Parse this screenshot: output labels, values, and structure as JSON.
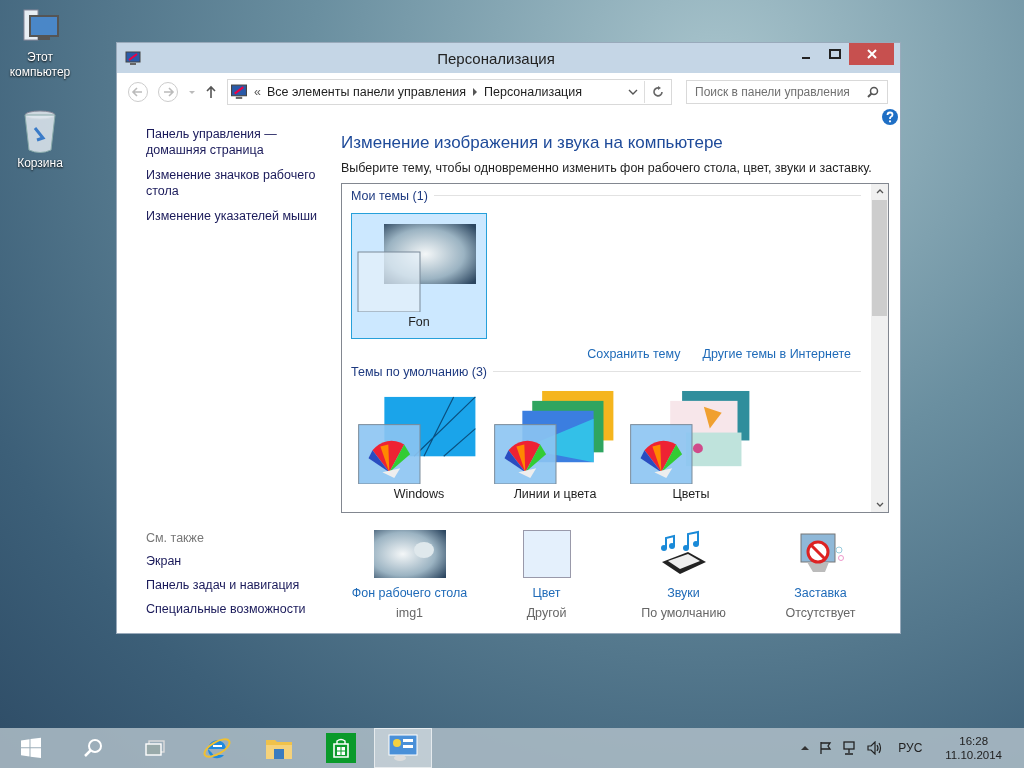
{
  "desktop_icons": [
    {
      "label": "Этот компьютер",
      "kind": "computer"
    },
    {
      "label": "Корзина",
      "kind": "bin"
    }
  ],
  "window": {
    "title": "Персонализация"
  },
  "address_bar": {
    "overflow": "«",
    "path": [
      "Все элементы панели управления",
      "Персонализация"
    ]
  },
  "search": {
    "placeholder": "Поиск в панели управления"
  },
  "sidebar": {
    "links": [
      "Панель управления — домашняя страница",
      "Изменение значков рабочего стола",
      "Изменение указателей мыши"
    ],
    "see_also_title": "См. также",
    "see_also": [
      "Экран",
      "Панель задач и навигация",
      "Специальные возможности"
    ]
  },
  "main": {
    "heading": "Изменение изображения и звука на компьютере",
    "description": "Выберите тему, чтобы одновременно изменить фон рабочего стола, цвет, звуки и заставку.",
    "groups": [
      {
        "title": "Мои темы (1)",
        "themes": [
          {
            "name": "Fon",
            "kind": "custom",
            "selected": true
          }
        ],
        "links": [
          "Сохранить тему",
          "Другие темы в Интернете"
        ]
      },
      {
        "title": "Темы по умолчанию (3)",
        "themes": [
          {
            "name": "Windows",
            "kind": "windows",
            "selected": false
          },
          {
            "name": "Линии и цвета",
            "kind": "lines",
            "selected": false
          },
          {
            "name": "Цветы",
            "kind": "flowers",
            "selected": false
          }
        ]
      }
    ]
  },
  "settings": [
    {
      "label": "Фон рабочего стола",
      "value": "img1",
      "kind": "background"
    },
    {
      "label": "Цвет",
      "value": "Другой",
      "kind": "color"
    },
    {
      "label": "Звуки",
      "value": "По умолчанию",
      "kind": "sounds"
    },
    {
      "label": "Заставка",
      "value": "Отсутствует",
      "kind": "screensaver"
    }
  ],
  "taskbar": {
    "apps": [
      {
        "kind": "start",
        "selected": false
      },
      {
        "kind": "search",
        "selected": false
      },
      {
        "kind": "task-view",
        "selected": false
      },
      {
        "kind": "browser",
        "selected": false
      },
      {
        "kind": "explorer",
        "selected": false
      },
      {
        "kind": "store",
        "selected": false
      },
      {
        "kind": "control-panel",
        "selected": true
      }
    ],
    "language": "РУС",
    "time": "16:28",
    "date": "11.10.2014"
  }
}
